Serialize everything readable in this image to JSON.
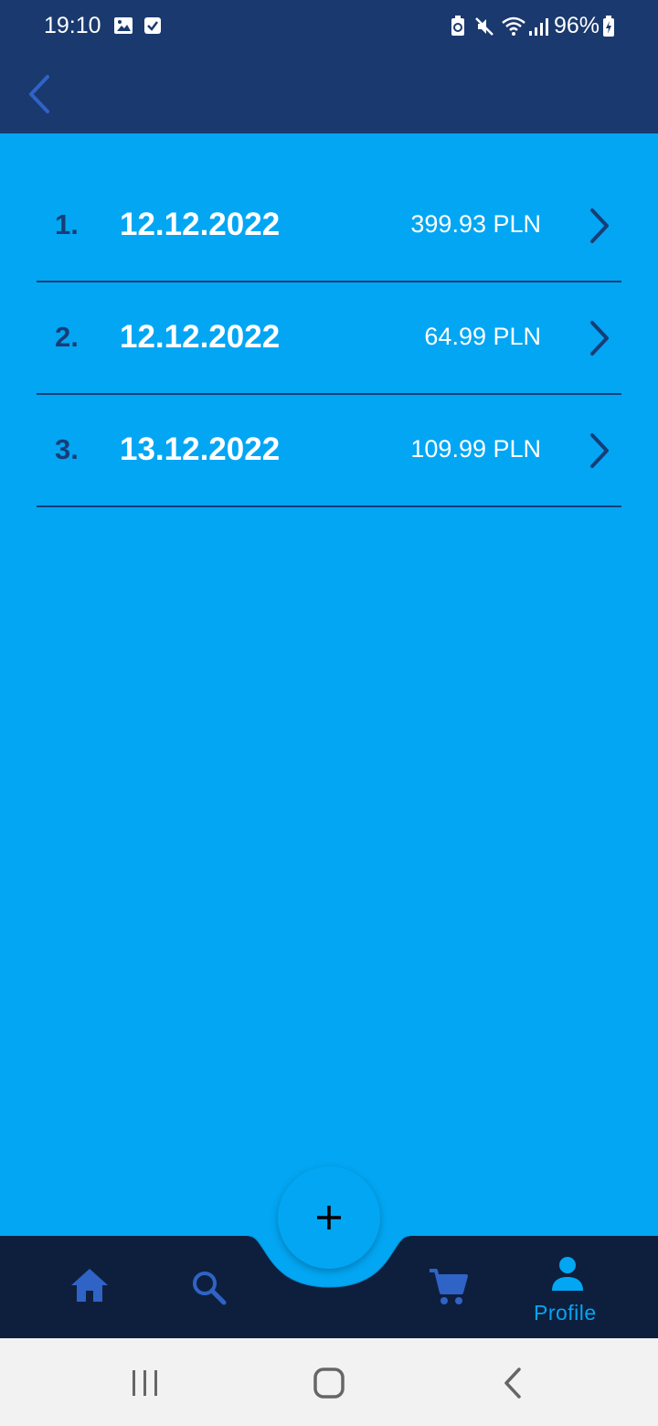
{
  "status_bar": {
    "time": "19:10",
    "battery_percent": "96%",
    "icons": [
      "image-icon",
      "check-square-icon",
      "battery-saver-icon",
      "mute-icon",
      "wifi-icon",
      "signal-icon",
      "battery-charging-icon"
    ]
  },
  "header": {
    "back_icon": "chevron-left-icon"
  },
  "orders": [
    {
      "index": "1.",
      "date": "12.12.2022",
      "amount": "399.93 PLN"
    },
    {
      "index": "2.",
      "date": "12.12.2022",
      "amount": "64.99 PLN"
    },
    {
      "index": "3.",
      "date": "13.12.2022",
      "amount": "109.99 PLN"
    }
  ],
  "bottom_nav": {
    "items": [
      "home-icon",
      "search-icon",
      "cart-icon",
      "profile-icon"
    ],
    "active_label": "Profile",
    "fab_icon": "plus-icon"
  },
  "colors": {
    "background": "#03a6f3",
    "header": "#1a396e",
    "nav": "#0e1f3e",
    "accent_dark": "#173d77",
    "icon_blue": "#2f63c6"
  }
}
